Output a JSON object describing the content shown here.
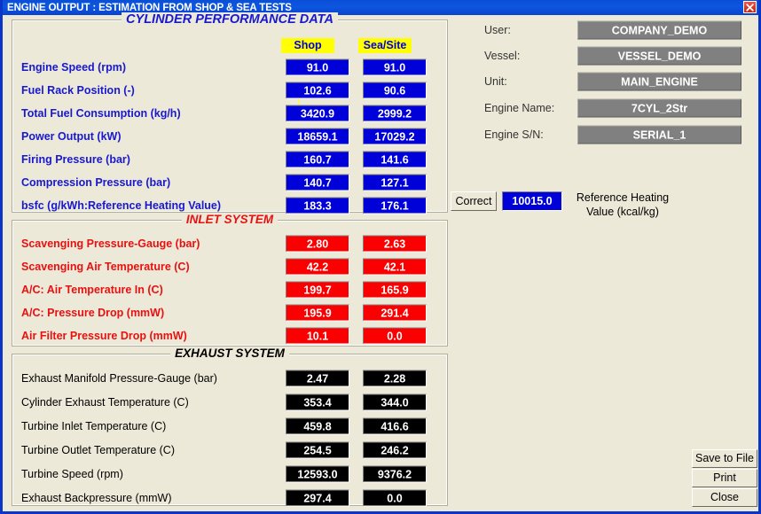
{
  "window": {
    "title": "ENGINE OUTPUT : ESTIMATION FROM SHOP & SEA TESTS",
    "close_icon": "close-icon",
    "titlebar_color": "#0A4FD6",
    "border_color": "#0A35C8",
    "background_color": "#ECE9D8"
  },
  "columns": {
    "shop": "Shop",
    "sea": "Sea/Site",
    "header_bg": "#FFFF00",
    "header_fg": "#0000D8"
  },
  "sections": [
    {
      "title": "CYLINDER PERFORMANCE DATA",
      "title_color": "#1818D0",
      "label_color": "#1818D0",
      "field_color": "#0000D8",
      "rows": [
        {
          "label": "Engine Speed (rpm)",
          "shop": "91.0",
          "sea": "91.0",
          "focused": true
        },
        {
          "label": "Fuel Rack Position (-)",
          "shop": "102.6",
          "sea": "90.6"
        },
        {
          "label": "Total Fuel Consumption (kg/h)",
          "shop": "3420.9",
          "sea": "2999.2"
        },
        {
          "label": "Power Output (kW)",
          "shop": "18659.1",
          "sea": "17029.2"
        },
        {
          "label": "Firing Pressure (bar)",
          "shop": "160.7",
          "sea": "141.6"
        },
        {
          "label": "Compression Pressure (bar)",
          "shop": "140.7",
          "sea": "127.1"
        },
        {
          "label": "bsfc (g/kWh:Reference Heating Value)",
          "shop": "183.3",
          "sea": "176.1"
        }
      ]
    },
    {
      "title": "INLET SYSTEM",
      "title_color": "#E81010",
      "label_color": "#E81010",
      "field_color": "#FA0000",
      "rows": [
        {
          "label": "Scavenging Pressure-Gauge (bar)",
          "shop": "2.80",
          "sea": "2.63"
        },
        {
          "label": "Scavenging Air Temperature (C)",
          "shop": "42.2",
          "sea": "42.1"
        },
        {
          "label": "A/C: Air Temperature In (C)",
          "shop": "199.7",
          "sea": "165.9"
        },
        {
          "label": "A/C: Pressure Drop (mmW)",
          "shop": "195.9",
          "sea": "291.4"
        },
        {
          "label": "Air Filter Pressure Drop (mmW)",
          "shop": "10.1",
          "sea": "0.0"
        }
      ]
    },
    {
      "title": "EXHAUST SYSTEM",
      "title_color": "#000000",
      "label_color": "#000000",
      "field_color": "#000000",
      "rows": [
        {
          "label": "Exhaust Manifold Pressure-Gauge (bar)",
          "shop": "2.47",
          "sea": "2.28"
        },
        {
          "label": "Cylinder Exhaust Temperature (C)",
          "shop": "353.4",
          "sea": "344.0"
        },
        {
          "label": "Turbine Inlet Temperature (C)",
          "shop": "459.8",
          "sea": "416.6"
        },
        {
          "label": "Turbine Outlet Temperature (C)",
          "shop": "254.5",
          "sea": "246.2"
        },
        {
          "label": "Turbine Speed (rpm)",
          "shop": "12593.0",
          "sea": "9376.2"
        },
        {
          "label": "Exhaust Backpressure (mmW)",
          "shop": "297.4",
          "sea": "0.0"
        }
      ]
    }
  ],
  "info": {
    "rows": [
      {
        "label": "User:",
        "value": "COMPANY_DEMO"
      },
      {
        "label": "Vessel:",
        "value": "VESSEL_DEMO"
      },
      {
        "label": "Unit:",
        "value": "MAIN_ENGINE"
      },
      {
        "label": "Engine Name:",
        "value": "7CYL_2Str"
      },
      {
        "label": "Engine S/N:",
        "value": "SERIAL_1"
      }
    ],
    "value_bg": "#808080"
  },
  "correct": {
    "button_label": "Correct",
    "value": "10015.0",
    "caption": "Reference Heating Value (kcal/kg)"
  },
  "actions": {
    "save": "Save to File",
    "print": "Print",
    "close": "Close"
  }
}
